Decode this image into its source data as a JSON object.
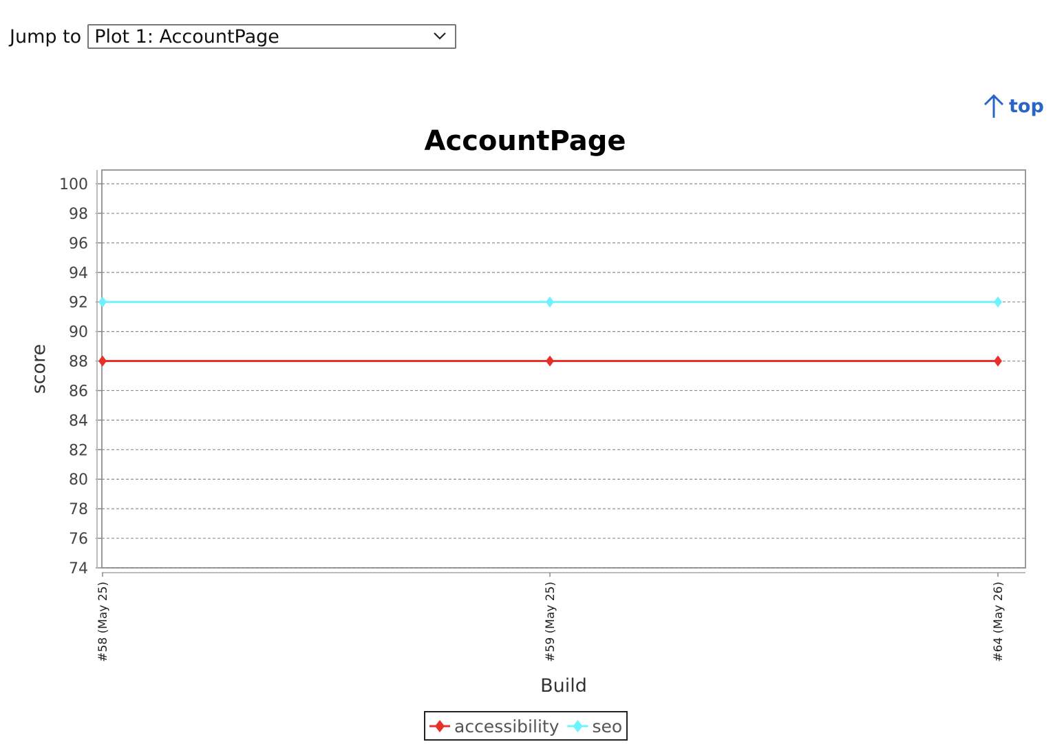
{
  "header": {
    "jump_label": "Jump to",
    "selected_plot": "Plot 1: AccountPage",
    "top_link": "top"
  },
  "colors": {
    "link": "#2a64c5",
    "accessibility": "#e8302a",
    "seo": "#6ff2ff",
    "gridline": "#8c8c8c"
  },
  "icons": {
    "dropdown": "chevron-down-icon",
    "top": "arrow-up-icon"
  },
  "chart_data": {
    "type": "line",
    "title": "AccountPage",
    "xlabel": "Build",
    "ylabel": "score",
    "categories": [
      "#58 (May 25)",
      "#59 (May 25)",
      "#64 (May 26)"
    ],
    "series": [
      {
        "name": "accessibility",
        "values": [
          88,
          88,
          88
        ],
        "color": "#e8302a"
      },
      {
        "name": "seo",
        "values": [
          92,
          92,
          92
        ],
        "color": "#6ff2ff"
      }
    ],
    "ylim": [
      74,
      100
    ],
    "yticks": [
      100,
      98,
      96,
      94,
      92,
      90,
      88,
      86,
      84,
      82,
      80,
      78,
      76,
      74
    ],
    "grid": true,
    "legend": "bottom-center"
  }
}
